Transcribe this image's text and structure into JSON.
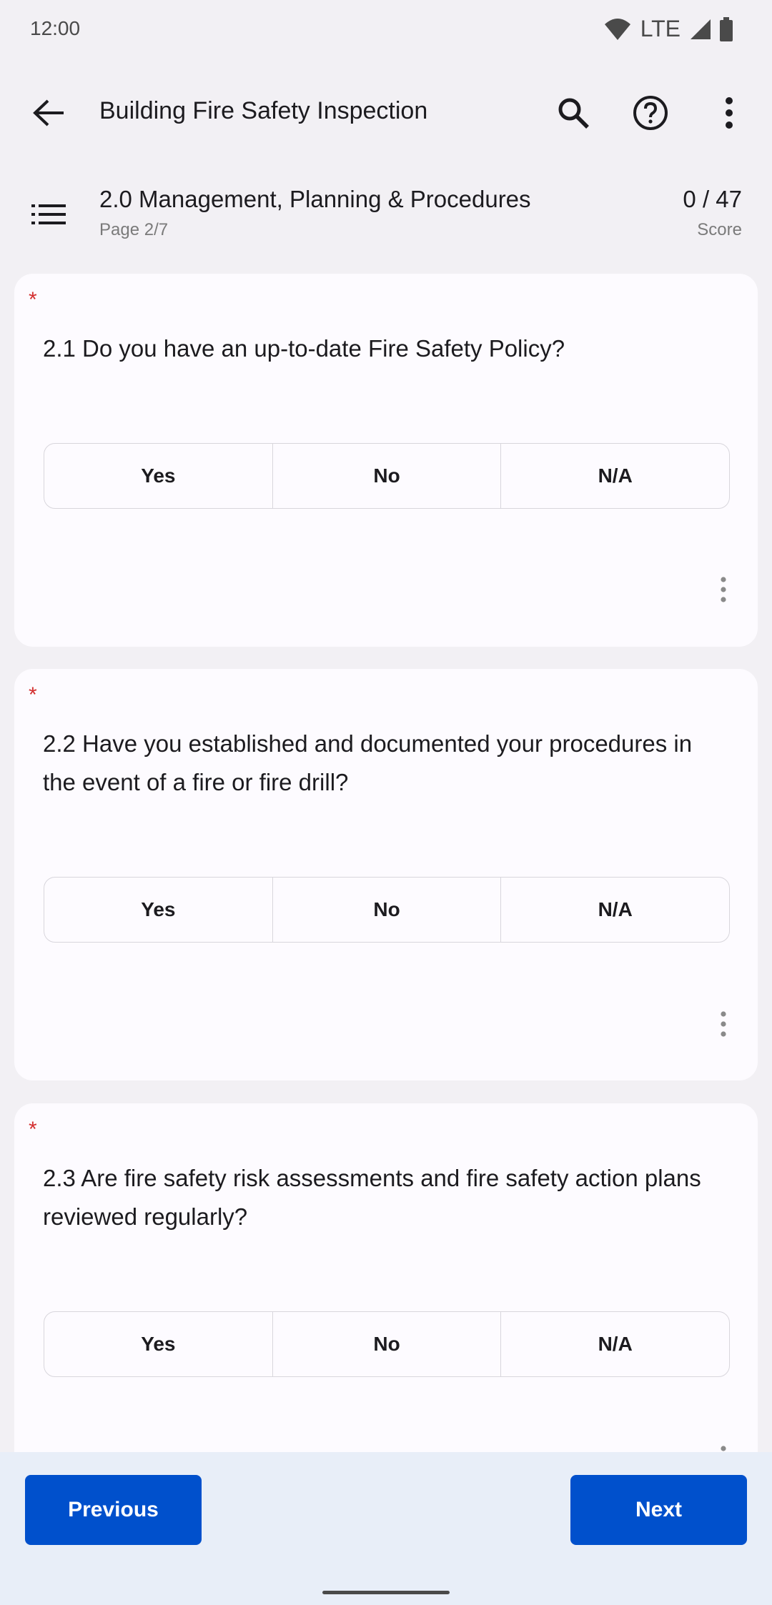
{
  "status_bar": {
    "time": "12:00",
    "network": "LTE"
  },
  "app_bar": {
    "title": "Building Fire Safety Inspection"
  },
  "section": {
    "title": "2.0 Management, Planning & Procedures",
    "page": "Page 2/7",
    "score": "0 / 47",
    "score_label": "Score"
  },
  "questions": [
    {
      "required_mark": "*",
      "text": "2.1 Do you have an up-to-date Fire Safety Policy?",
      "options": [
        "Yes",
        "No",
        "N/A"
      ]
    },
    {
      "required_mark": "*",
      "text": "2.2 Have you established and documented your procedures in the event of a fire or fire drill?",
      "options": [
        "Yes",
        "No",
        "N/A"
      ]
    },
    {
      "required_mark": "*",
      "text": "2.3 Are fire safety risk assessments and fire safety action plans reviewed regularly?",
      "options": [
        "Yes",
        "No",
        "N/A"
      ]
    }
  ],
  "footer": {
    "previous_label": "Previous",
    "next_label": "Next"
  },
  "colors": {
    "primary": "#0050cc",
    "required": "#d32f2f",
    "background": "#f2f0f4",
    "card": "#fdfbff",
    "bottom_bar": "#e8eef8"
  },
  "icons": [
    "wifi-icon",
    "signal-icon",
    "battery-icon",
    "back-arrow-icon",
    "search-icon",
    "help-icon",
    "more-vert-icon",
    "list-icon"
  ]
}
